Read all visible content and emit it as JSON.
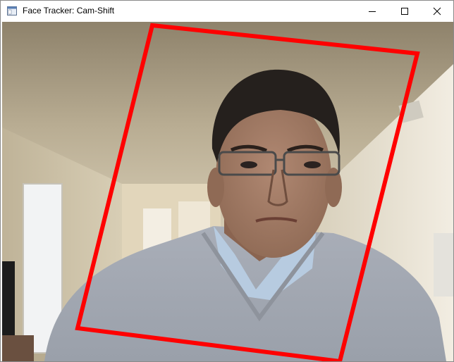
{
  "window": {
    "title": "Face Tracker: Cam-Shift",
    "app_icon": "window-app-icon",
    "controls": {
      "minimize": "minimize-icon",
      "maximize": "maximize-icon",
      "close": "close-icon"
    }
  },
  "video": {
    "description_icon": "camera-frame",
    "tracking_box_color": "#ff0000"
  }
}
